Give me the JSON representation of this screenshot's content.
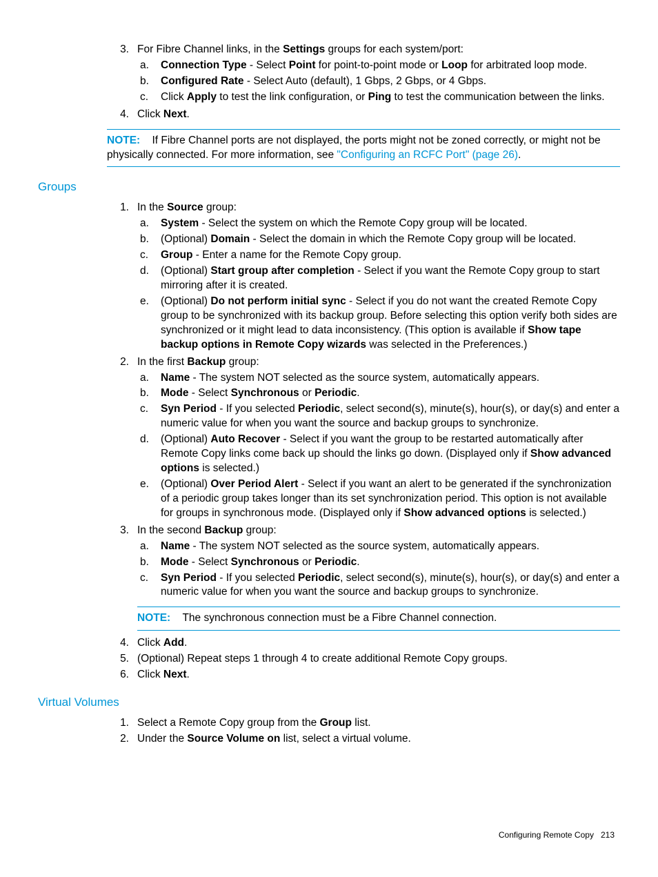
{
  "step3": {
    "num": "3.",
    "text_pre": "For Fibre Channel links, in the ",
    "b1": "Settings",
    "text_post": " groups for each system/port:",
    "a": {
      "m": "a.",
      "b1": "Connection Type",
      "t1": " - Select ",
      "b2": "Point",
      "t2": " for point-to-point mode or ",
      "b3": "Loop",
      "t3": " for arbitrated loop mode."
    },
    "b": {
      "m": "b.",
      "b1": "Configured Rate",
      "t1": " - Select Auto (default), 1 Gbps, 2 Gbps, or 4 Gbps."
    },
    "c": {
      "m": "c.",
      "t0": "Click ",
      "b1": "Apply",
      "t1": " to test the link configuration, or ",
      "b2": "Ping",
      "t2": " to test the communication between the links."
    }
  },
  "step4": {
    "num": "4.",
    "t0": "Click ",
    "b1": "Next",
    "t1": "."
  },
  "note1": {
    "label": "NOTE:",
    "t1": "If Fibre Channel ports are not displayed, the ports might not be zoned correctly, or might not be physically connected. For more information, see ",
    "link": "\"Configuring an RCFC Port\" (page 26)",
    "t2": "."
  },
  "groups": {
    "heading": "Groups",
    "s1": {
      "num": "1.",
      "t0": "In the ",
      "b0": "Source",
      "t1": " group:",
      "a": {
        "m": "a.",
        "b1": "System",
        "t1": " - Select the system on which the Remote Copy group will be located."
      },
      "b": {
        "m": "b.",
        "t0": "(Optional) ",
        "b1": "Domain",
        "t1": " - Select the domain in which the Remote Copy group will be located."
      },
      "c": {
        "m": "c.",
        "b1": "Group",
        "t1": " - Enter a name for the Remote Copy group."
      },
      "d": {
        "m": "d.",
        "t0": "(Optional) ",
        "b1": "Start group after completion",
        "t1": " - Select if you want the Remote Copy group to start mirroring after it is created."
      },
      "e": {
        "m": "e.",
        "t0": "(Optional) ",
        "b1": "Do not perform initial sync",
        "t1": " - Select if you do not want the created Remote Copy group to be synchronized with its backup group. Before selecting this option verify both sides are synchronized or it might lead to data inconsistency. (This option is available if ",
        "b2": "Show tape backup options in Remote Copy wizards",
        "t2": " was selected in the Preferences.)"
      }
    },
    "s2": {
      "num": "2.",
      "t0": "In the first ",
      "b0": "Backup",
      "t1": " group:",
      "a": {
        "m": "a.",
        "b1": "Name",
        "t1": " - The system NOT selected as the source system, automatically appears."
      },
      "b": {
        "m": "b.",
        "b1": "Mode",
        "t1": " - Select ",
        "b2": "Synchronous",
        "t2": " or ",
        "b3": "Periodic",
        "t3": "."
      },
      "c": {
        "m": "c.",
        "b1": "Syn Period",
        "t1": " - If you selected ",
        "b2": "Periodic",
        "t2": ", select second(s), minute(s), hour(s), or day(s) and enter a numeric value for when you want the source and backup groups to synchronize."
      },
      "d": {
        "m": "d.",
        "t0": "(Optional) ",
        "b1": "Auto Recover",
        "t1": " - Select if you want the group to be restarted automatically after Remote Copy links come back up should the links go down. (Displayed only if ",
        "b2": "Show advanced options",
        "t2": " is selected.)"
      },
      "e": {
        "m": "e.",
        "t0": "(Optional) ",
        "b1": "Over Period Alert",
        "t1": " - Select if you want an alert to be generated if the synchronization of a periodic group takes longer than its set synchronization period. This option is not available for groups in synchronous mode. (Displayed only if ",
        "b2": "Show advanced options",
        "t2": " is selected.)"
      }
    },
    "s3": {
      "num": "3.",
      "t0": "In the second ",
      "b0": "Backup",
      "t1": " group:",
      "a": {
        "m": "a.",
        "b1": "Name",
        "t1": " - The system NOT selected as the source system, automatically appears."
      },
      "b": {
        "m": "b.",
        "b1": "Mode",
        "t1": " - Select ",
        "b2": "Synchronous",
        "t2": " or ",
        "b3": "Periodic",
        "t3": "."
      },
      "c": {
        "m": "c.",
        "b1": "Syn Period",
        "t1": " - If you selected ",
        "b2": "Periodic",
        "t2": ", select second(s), minute(s), hour(s), or day(s) and enter a numeric value for when you want the source and backup groups to synchronize."
      },
      "note": {
        "label": "NOTE:",
        "t1": "The synchronous connection must be a Fibre Channel connection."
      }
    },
    "s4": {
      "num": "4.",
      "t0": "Click ",
      "b1": "Add",
      "t1": "."
    },
    "s5": {
      "num": "5.",
      "t0": "(Optional) Repeat steps 1 through 4 to create additional Remote Copy groups."
    },
    "s6": {
      "num": "6.",
      "t0": "Click ",
      "b1": "Next",
      "t1": "."
    }
  },
  "vv": {
    "heading": "Virtual Volumes",
    "s1": {
      "num": "1.",
      "t0": "Select a Remote Copy group from the ",
      "b1": "Group",
      "t1": " list."
    },
    "s2": {
      "num": "2.",
      "t0": "Under the ",
      "b1": "Source Volume on",
      "t1": " list, select a virtual volume."
    }
  },
  "footer": {
    "title": "Configuring Remote Copy",
    "page": "213"
  }
}
